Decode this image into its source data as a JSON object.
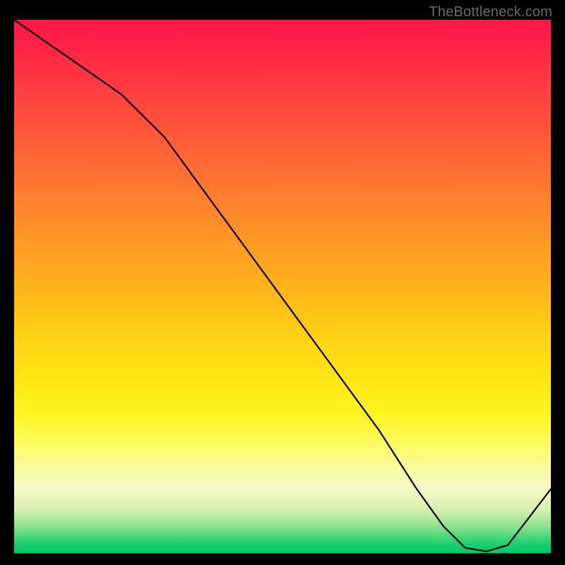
{
  "watermark": "TheBottleneck.com",
  "chart_data": {
    "type": "line",
    "xlim": [
      0,
      100
    ],
    "ylim": [
      0,
      100
    ],
    "x": [
      0,
      10,
      20,
      28,
      36,
      44,
      52,
      60,
      68,
      75,
      80,
      84,
      88,
      92,
      100
    ],
    "values": [
      100,
      93,
      86,
      78,
      67,
      56,
      45,
      34,
      23,
      12,
      5,
      1,
      0.3,
      1.5,
      12
    ],
    "title": "",
    "xlabel": "",
    "ylabel": "",
    "line_color": "#000000",
    "marker": {
      "label": "",
      "x_range": [
        80,
        90
      ],
      "y": 0.5
    }
  }
}
